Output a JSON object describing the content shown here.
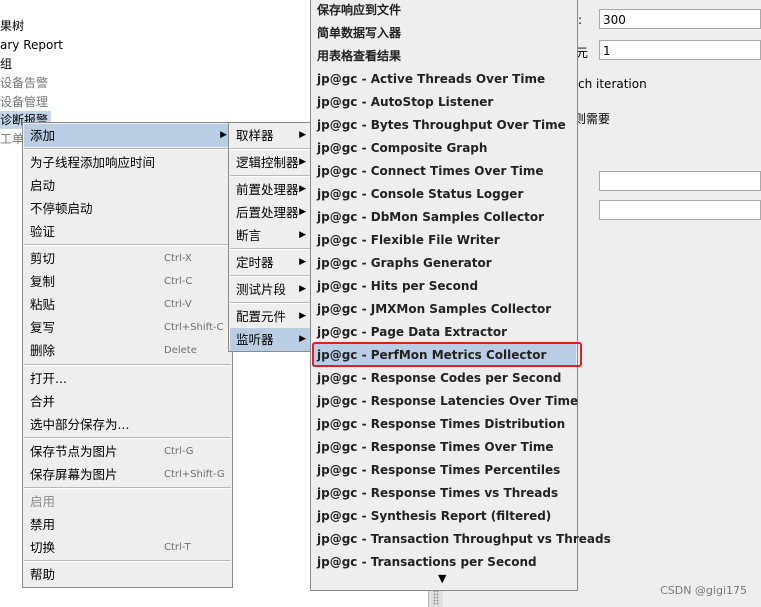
{
  "tree": {
    "items": [
      {
        "label": "果树",
        "faded": false
      },
      {
        "label": "ary Report",
        "faded": false
      },
      {
        "label": "组",
        "faded": false
      },
      {
        "label": "设备告警",
        "faded": true
      },
      {
        "label": "设备管理",
        "faded": true
      },
      {
        "label": "诊断报警",
        "faded": false
      },
      {
        "label": "工单",
        "faded": true
      }
    ]
  },
  "right_panel": {
    "field1_label": ":",
    "field1_value": "300",
    "field2_label": "元",
    "field2_value": "1",
    "text1": "ch iteration",
    "text2": "则需要"
  },
  "context_menu": {
    "items": [
      {
        "label": "添加",
        "shortcut": "",
        "submenu": true,
        "selected": true,
        "disabled": false
      },
      {
        "label": "为子线程添加响应时间",
        "shortcut": "",
        "submenu": false,
        "disabled": false
      },
      {
        "label": "启动",
        "shortcut": "",
        "submenu": false,
        "disabled": false
      },
      {
        "label": "不停顿启动",
        "shortcut": "",
        "submenu": false,
        "disabled": false
      },
      {
        "label": "验证",
        "shortcut": "",
        "submenu": false,
        "disabled": false
      },
      {
        "label": "剪切",
        "shortcut": "Ctrl-X",
        "submenu": false,
        "disabled": false
      },
      {
        "label": "复制",
        "shortcut": "Ctrl-C",
        "submenu": false,
        "disabled": false
      },
      {
        "label": "粘贴",
        "shortcut": "Ctrl-V",
        "submenu": false,
        "disabled": false
      },
      {
        "label": "复写",
        "shortcut": "Ctrl+Shift-C",
        "submenu": false,
        "disabled": false
      },
      {
        "label": "删除",
        "shortcut": "Delete",
        "submenu": false,
        "disabled": false
      },
      {
        "label": "打开...",
        "shortcut": "",
        "submenu": false,
        "disabled": false
      },
      {
        "label": "合并",
        "shortcut": "",
        "submenu": false,
        "disabled": false
      },
      {
        "label": "选中部分保存为...",
        "shortcut": "",
        "submenu": false,
        "disabled": false
      },
      {
        "label": "保存节点为图片",
        "shortcut": "Ctrl-G",
        "submenu": false,
        "disabled": false
      },
      {
        "label": "保存屏幕为图片",
        "shortcut": "Ctrl+Shift-G",
        "submenu": false,
        "disabled": false
      },
      {
        "label": "启用",
        "shortcut": "",
        "submenu": false,
        "disabled": true
      },
      {
        "label": "禁用",
        "shortcut": "",
        "submenu": false,
        "disabled": false
      },
      {
        "label": "切换",
        "shortcut": "Ctrl-T",
        "submenu": false,
        "disabled": false
      },
      {
        "label": "帮助",
        "shortcut": "",
        "submenu": false,
        "disabled": false
      }
    ]
  },
  "add_submenu": {
    "items": [
      {
        "label": "取样器",
        "selected": false
      },
      {
        "label": "逻辑控制器",
        "selected": false
      },
      {
        "label": "前置处理器",
        "selected": false
      },
      {
        "label": "后置处理器",
        "selected": false
      },
      {
        "label": "断言",
        "selected": false
      },
      {
        "label": "定时器",
        "selected": false
      },
      {
        "label": "测试片段",
        "selected": false
      },
      {
        "label": "配置元件",
        "selected": false
      },
      {
        "label": "监听器",
        "selected": true
      }
    ]
  },
  "listener_submenu": {
    "items": [
      {
        "label": "保存响应到文件",
        "selected": false
      },
      {
        "label": "简单数据写入器",
        "selected": false
      },
      {
        "label": "用表格查看结果",
        "selected": false
      },
      {
        "label": "jp@gc - Active Threads Over Time",
        "selected": false
      },
      {
        "label": "jp@gc - AutoStop Listener",
        "selected": false
      },
      {
        "label": "jp@gc - Bytes Throughput Over Time",
        "selected": false
      },
      {
        "label": "jp@gc - Composite Graph",
        "selected": false
      },
      {
        "label": "jp@gc - Connect Times Over Time",
        "selected": false
      },
      {
        "label": "jp@gc - Console Status Logger",
        "selected": false
      },
      {
        "label": "jp@gc - DbMon Samples Collector",
        "selected": false
      },
      {
        "label": "jp@gc - Flexible File Writer",
        "selected": false
      },
      {
        "label": "jp@gc - Graphs Generator",
        "selected": false
      },
      {
        "label": "jp@gc - Hits per Second",
        "selected": false
      },
      {
        "label": "jp@gc - JMXMon Samples Collector",
        "selected": false
      },
      {
        "label": "jp@gc - Page Data Extractor",
        "selected": false
      },
      {
        "label": "jp@gc - PerfMon Metrics Collector",
        "selected": true
      },
      {
        "label": "jp@gc - Response Codes per Second",
        "selected": false
      },
      {
        "label": "jp@gc - Response Latencies Over Time",
        "selected": false
      },
      {
        "label": "jp@gc - Response Times Distribution",
        "selected": false
      },
      {
        "label": "jp@gc - Response Times Over Time",
        "selected": false
      },
      {
        "label": "jp@gc - Response Times Percentiles",
        "selected": false
      },
      {
        "label": "jp@gc - Response Times vs Threads",
        "selected": false
      },
      {
        "label": "jp@gc - Synthesis Report (filtered)",
        "selected": false
      },
      {
        "label": "jp@gc - Transaction Throughput vs Threads",
        "selected": false
      },
      {
        "label": "jp@gc - Transactions per Second",
        "selected": false
      }
    ],
    "more_indicator": "▼"
  },
  "icons": {
    "submenu_arrow": "▶",
    "scroll_more": "▼"
  },
  "watermark": "CSDN @gigi175",
  "colors": {
    "selection": "#b9cde5",
    "highlight_border": "#e02020"
  }
}
